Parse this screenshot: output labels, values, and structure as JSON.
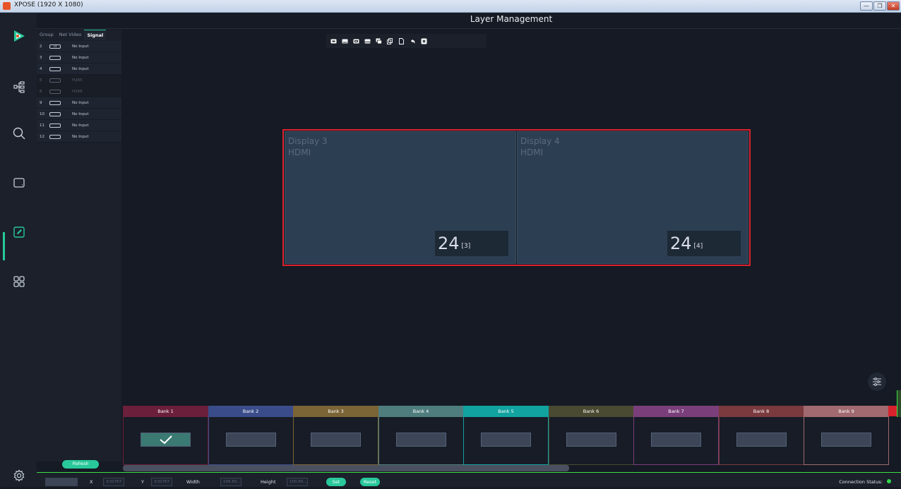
{
  "window": {
    "title": "XPOSE (1920 X 1080)",
    "minimize": "—",
    "restore": "❐",
    "close": "✕"
  },
  "header": {
    "title": "Layer Management"
  },
  "signal_panel": {
    "tabs": [
      "Group",
      "Net Video",
      "Signal"
    ],
    "rows": [
      {
        "num": "2",
        "conn": "14",
        "label": "No Input",
        "dim": false
      },
      {
        "num": "3",
        "conn": "",
        "label": "No Input",
        "dim": false
      },
      {
        "num": "4",
        "conn": "",
        "label": "No Input",
        "dim": false
      },
      {
        "num": "6",
        "conn": "",
        "label": "H265",
        "dim": true
      },
      {
        "num": "8",
        "conn": "",
        "label": "H268",
        "dim": true
      },
      {
        "num": "9",
        "conn": "",
        "label": "No Input",
        "dim": false
      },
      {
        "num": "10",
        "conn": "",
        "label": "No Input",
        "dim": false
      },
      {
        "num": "11",
        "conn": "",
        "label": "No Input",
        "dim": false
      },
      {
        "num": "12",
        "conn": "",
        "label": "No Input",
        "dim": false
      }
    ],
    "refresh_label": "Refresh"
  },
  "displays": [
    {
      "name": "Display 3",
      "signal": "HDMI",
      "layer_value": "24",
      "layer_index": "[3]"
    },
    {
      "name": "Display 4",
      "signal": "HDMI",
      "layer_value": "24",
      "layer_index": "[4]"
    }
  ],
  "banks": [
    {
      "label": "Bank 1",
      "color": "#6b1f3a",
      "selected": true
    },
    {
      "label": "Bank 2",
      "color": "#3a4d8a",
      "selected": false
    },
    {
      "label": "Bank 3",
      "color": "#7b6436",
      "selected": false
    },
    {
      "label": "Bank 4",
      "color": "#4f7d7d",
      "selected": false
    },
    {
      "label": "Bank 5",
      "color": "#11a3a0",
      "selected": false
    },
    {
      "label": "Bank 6",
      "color": "#4a4a32",
      "selected": false
    },
    {
      "label": "Bank 7",
      "color": "#7a3f7a",
      "selected": false
    },
    {
      "label": "Bank 8",
      "color": "#7a3a3e",
      "selected": false
    },
    {
      "label": "Bank 9",
      "color": "#a06a70",
      "selected": false
    }
  ],
  "bottom": {
    "x_label": "X",
    "x_placeholder": "±32767",
    "y_label": "Y",
    "y_placeholder": "±32767",
    "width_label": "Width",
    "width_placeholder": "100-65...",
    "height_label": "Height",
    "height_placeholder": "100-65...",
    "set_label": "Set",
    "reset_label": "Reset",
    "connection_label": "Connection Status:",
    "connection_color": "#31d84a"
  },
  "colors": {
    "accent": "#28c89a",
    "selection_frame": "#d8222e"
  },
  "icons": {
    "nav": [
      "logo-icon",
      "topology-icon",
      "search-icon",
      "screen-icon",
      "edit-icon",
      "apps-icon",
      "settings-icon"
    ],
    "toolbar": [
      "layer-front-icon",
      "layer-back-icon",
      "layer-forward-icon",
      "layer-backward-icon",
      "layer-stack-icon",
      "copy-icon",
      "paste-icon",
      "undo-icon",
      "clear-icon"
    ]
  }
}
